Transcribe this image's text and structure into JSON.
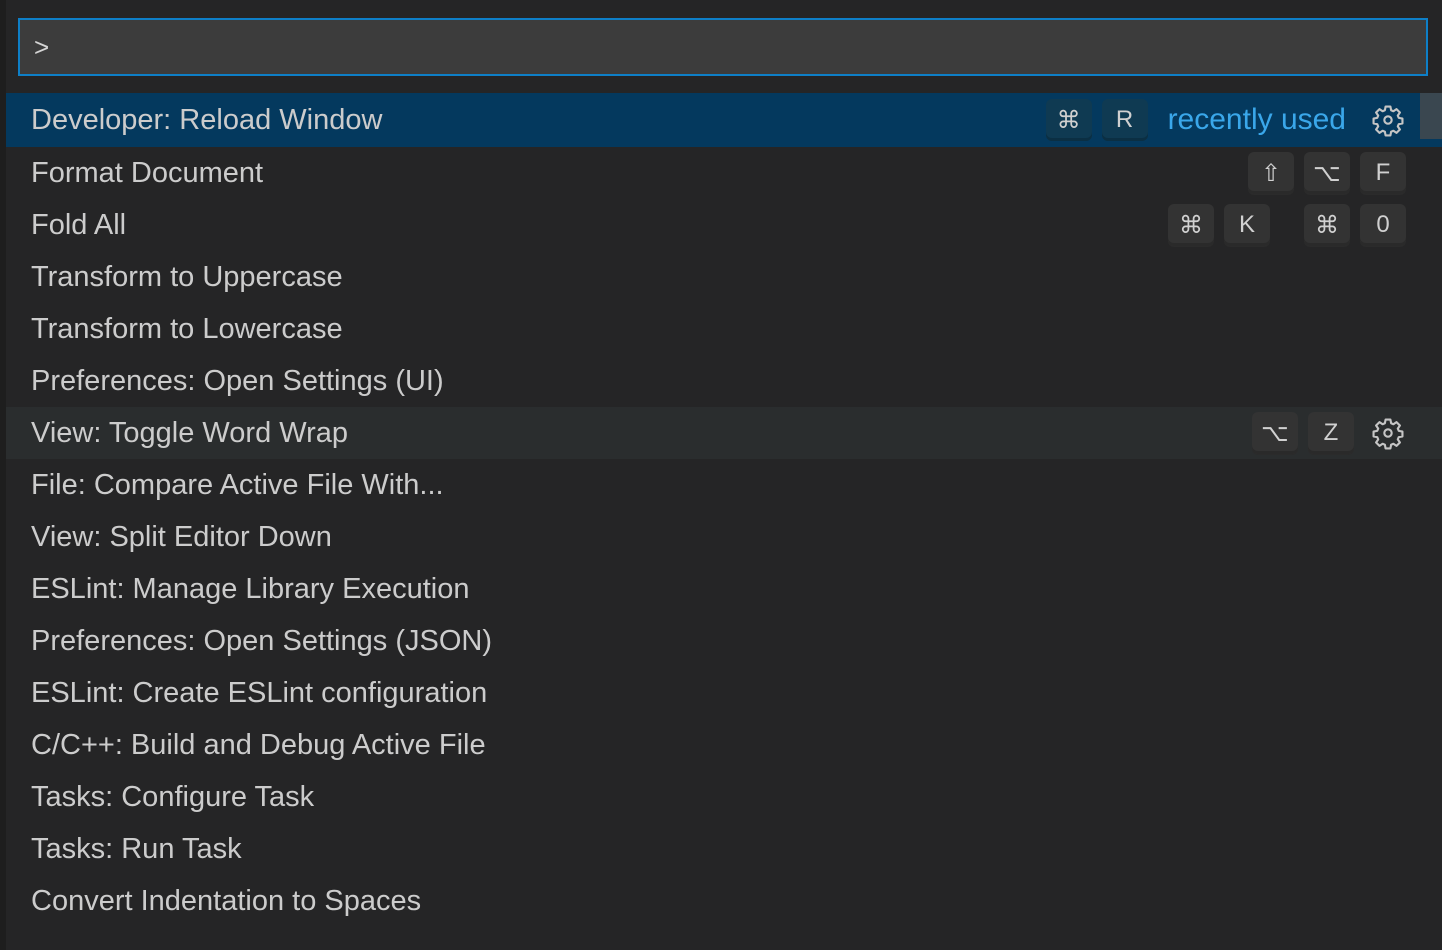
{
  "input": {
    "value": ">",
    "placeholder": ""
  },
  "recently_used_label": "recently used",
  "commands": [
    {
      "label": "Developer: Reload Window",
      "keys": [
        [
          "⌘",
          "R"
        ]
      ],
      "state": "selected",
      "recently_used": true,
      "gear": true
    },
    {
      "label": "Format Document",
      "keys": [
        [
          "⇧",
          "⌥",
          "F"
        ]
      ],
      "state": "",
      "recently_used": false,
      "gear": false
    },
    {
      "label": "Fold All",
      "keys": [
        [
          "⌘",
          "K"
        ],
        [
          "⌘",
          "0"
        ]
      ],
      "state": "",
      "recently_used": false,
      "gear": false
    },
    {
      "label": "Transform to Uppercase",
      "keys": [],
      "state": "",
      "recently_used": false,
      "gear": false
    },
    {
      "label": "Transform to Lowercase",
      "keys": [],
      "state": "",
      "recently_used": false,
      "gear": false
    },
    {
      "label": "Preferences: Open Settings (UI)",
      "keys": [],
      "state": "",
      "recently_used": false,
      "gear": false
    },
    {
      "label": "View: Toggle Word Wrap",
      "keys": [
        [
          "⌥",
          "Z"
        ]
      ],
      "state": "hover",
      "recently_used": false,
      "gear": true
    },
    {
      "label": "File: Compare Active File With...",
      "keys": [],
      "state": "",
      "recently_used": false,
      "gear": false
    },
    {
      "label": "View: Split Editor Down",
      "keys": [],
      "state": "",
      "recently_used": false,
      "gear": false
    },
    {
      "label": "ESLint: Manage Library Execution",
      "keys": [],
      "state": "",
      "recently_used": false,
      "gear": false
    },
    {
      "label": "Preferences: Open Settings (JSON)",
      "keys": [],
      "state": "",
      "recently_used": false,
      "gear": false
    },
    {
      "label": "ESLint: Create ESLint configuration",
      "keys": [],
      "state": "",
      "recently_used": false,
      "gear": false
    },
    {
      "label": "C/C++: Build and Debug Active File",
      "keys": [],
      "state": "",
      "recently_used": false,
      "gear": false
    },
    {
      "label": "Tasks: Configure Task",
      "keys": [],
      "state": "",
      "recently_used": false,
      "gear": false
    },
    {
      "label": "Tasks: Run Task",
      "keys": [],
      "state": "",
      "recently_used": false,
      "gear": false
    },
    {
      "label": "Convert Indentation to Spaces",
      "keys": [],
      "state": "",
      "recently_used": false,
      "gear": false
    }
  ]
}
